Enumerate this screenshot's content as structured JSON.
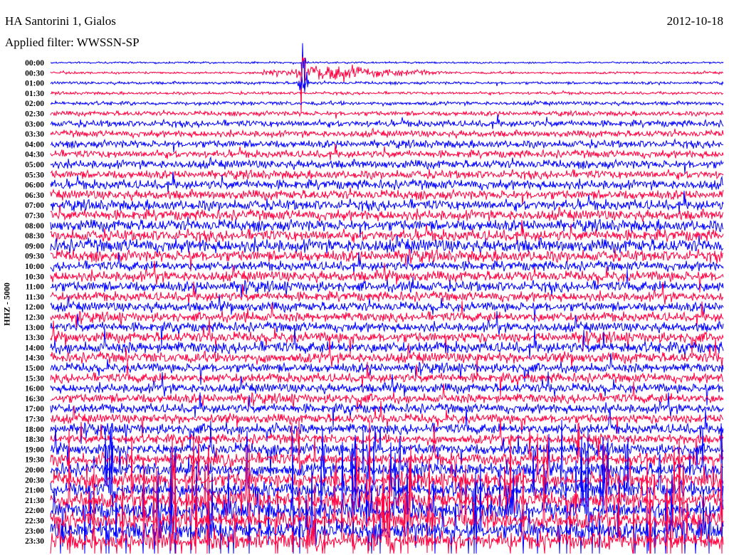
{
  "header": {
    "station": "HA Santorini 1, Gialos",
    "filter": "Applied filter: WWSSN-SP",
    "date": "2012-10-18"
  },
  "chart_data": {
    "type": "line",
    "title": "HA Santorini 1, Gialos",
    "subtitle": "Applied filter: WWSSN-SP",
    "ylabel": "HHZ - 5000",
    "xlabel": "",
    "series_colors": [
      "#0000ff",
      "#ff0040"
    ],
    "row_labels": [
      "00:00",
      "00:30",
      "01:00",
      "01:30",
      "02:00",
      "02:30",
      "03:00",
      "03:30",
      "04:00",
      "04:30",
      "05:00",
      "05:30",
      "06:00",
      "06:30",
      "07:00",
      "07:30",
      "08:00",
      "08:30",
      "09:00",
      "09:30",
      "10:00",
      "10:30",
      "11:00",
      "11:30",
      "12:00",
      "12:30",
      "13:00",
      "13:30",
      "14:00",
      "14:30",
      "15:00",
      "15:30",
      "16:00",
      "16:30",
      "17:00",
      "17:30",
      "18:00",
      "18:30",
      "19:00",
      "19:30",
      "20:00",
      "20:30",
      "21:00",
      "21:30",
      "22:00",
      "22:30",
      "23:00",
      "23:30"
    ],
    "relative_noise_level": [
      1,
      1.2,
      1.5,
      1.5,
      2,
      2.5,
      3.5,
      3.5,
      4,
      4,
      4.5,
      4.5,
      5,
      5,
      5.5,
      5.5,
      6,
      6,
      7,
      6,
      5,
      5.5,
      5.5,
      5,
      5,
      5,
      5,
      5.5,
      6,
      5.5,
      5,
      5,
      5,
      5,
      5,
      5,
      5.5,
      5,
      6,
      6.5,
      7,
      7.5,
      8,
      8.5,
      9,
      9,
      9,
      9
    ],
    "relative_spike_rate": [
      0.5,
      1,
      0.8,
      0.6,
      0.6,
      0.8,
      1,
      1,
      1,
      1,
      1,
      1,
      1,
      1,
      1,
      1,
      1,
      1,
      1,
      1.2,
      1.5,
      1.8,
      2,
      2,
      2,
      2.2,
      2.5,
      3,
      3,
      3,
      2.5,
      2.5,
      2.5,
      2.5,
      2.5,
      3,
      3.5,
      4,
      5,
      6,
      7,
      8,
      9,
      10,
      10,
      10,
      10,
      10
    ],
    "event_minute": 11.3,
    "window_minutes": 30
  }
}
